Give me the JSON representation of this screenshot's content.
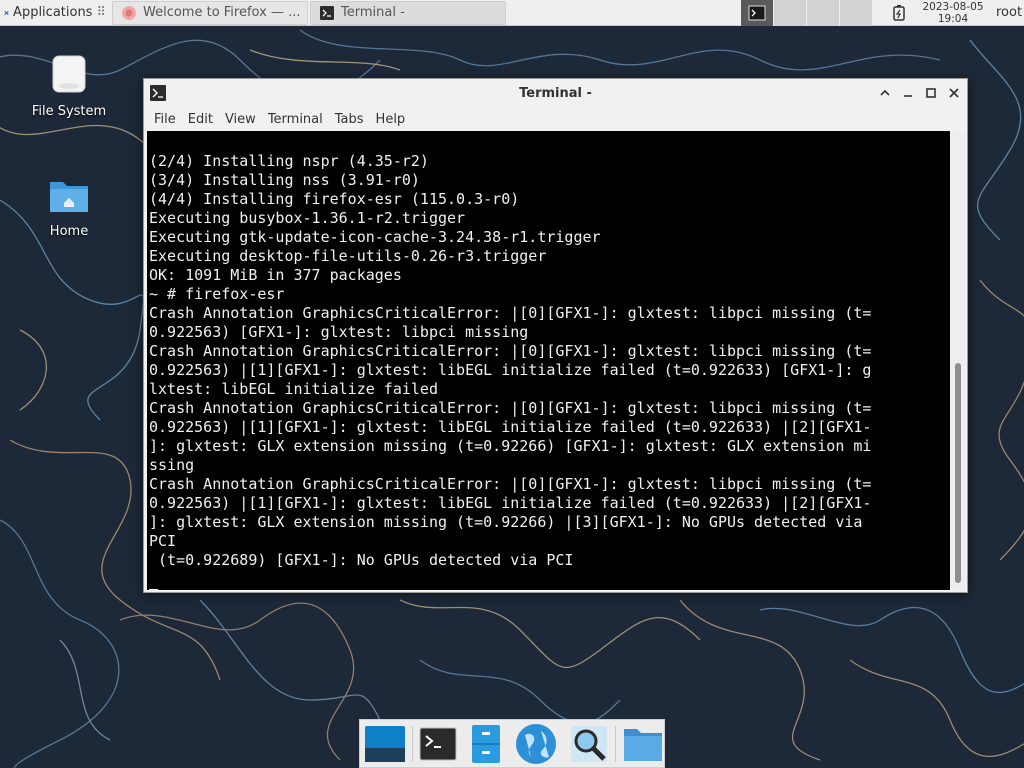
{
  "panel": {
    "applications_label": "Applications",
    "tasks": [
      {
        "label": "Welcome to Firefox — ..."
      },
      {
        "label": "Terminal -"
      }
    ],
    "clock_date": "2023-08-05",
    "clock_time": "19:04",
    "user": "root"
  },
  "desktop": {
    "icons": [
      {
        "label": "File System"
      },
      {
        "label": "Home"
      }
    ]
  },
  "window": {
    "title": "Terminal -",
    "menu": [
      "File",
      "Edit",
      "View",
      "Terminal",
      "Tabs",
      "Help"
    ]
  },
  "terminal": {
    "lines": [
      "(2/4) Installing nspr (4.35-r2)",
      "(3/4) Installing nss (3.91-r0)",
      "(4/4) Installing firefox-esr (115.0.3-r0)",
      "Executing busybox-1.36.1-r2.trigger",
      "Executing gtk-update-icon-cache-3.24.38-r1.trigger",
      "Executing desktop-file-utils-0.26-r3.trigger",
      "OK: 1091 MiB in 377 packages",
      "~ # firefox-esr",
      "Crash Annotation GraphicsCriticalError: |[0][GFX1-]: glxtest: libpci missing (t=",
      "0.922563) [GFX1-]: glxtest: libpci missing",
      "Crash Annotation GraphicsCriticalError: |[0][GFX1-]: glxtest: libpci missing (t=",
      "0.922563) |[1][GFX1-]: glxtest: libEGL initialize failed (t=0.922633) [GFX1-]: g",
      "lxtest: libEGL initialize failed",
      "Crash Annotation GraphicsCriticalError: |[0][GFX1-]: glxtest: libpci missing (t=",
      "0.922563) |[1][GFX1-]: glxtest: libEGL initialize failed (t=0.922633) |[2][GFX1-",
      "]: glxtest: GLX extension missing (t=0.92266) [GFX1-]: glxtest: GLX extension mi",
      "ssing",
      "Crash Annotation GraphicsCriticalError: |[0][GFX1-]: glxtest: libpci missing (t=",
      "0.922563) |[1][GFX1-]: glxtest: libEGL initialize failed (t=0.922633) |[2][GFX1-",
      "]: glxtest: GLX extension missing (t=0.92266) |[3][GFX1-]: No GPUs detected via ",
      "PCI",
      " (t=0.922689) [GFX1-]: No GPUs detected via PCI",
      ""
    ]
  },
  "colors": {
    "wallpaper": "#1d2838",
    "terminal_bg": "#000000",
    "terminal_fg": "#f0f0f0",
    "folder_blue": "#4aa3df"
  },
  "icons": {
    "panel": [
      "xfce-mouse-icon",
      "firefox-icon",
      "terminal-icon",
      "battery-icon"
    ],
    "dock": [
      "desktop-icon",
      "terminal-icon",
      "file-cabinet-icon",
      "web-browser-globe-icon",
      "search-magnifier-icon",
      "folder-icon"
    ]
  }
}
